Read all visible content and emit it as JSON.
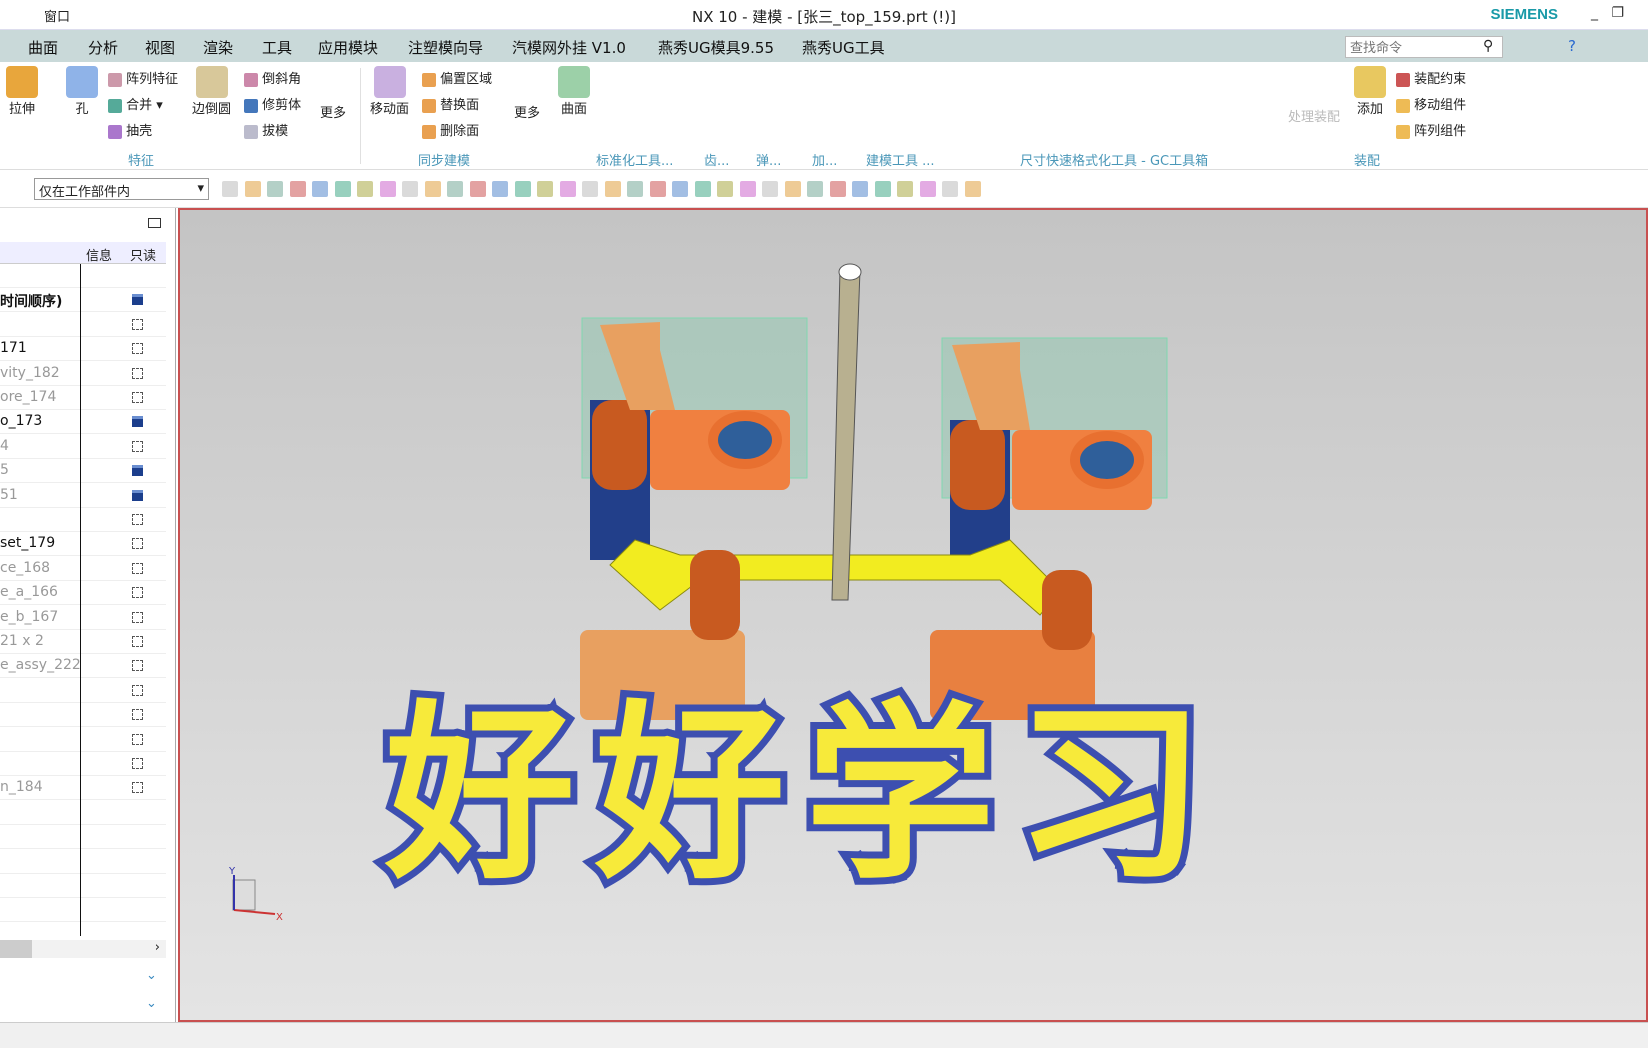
{
  "titlebar": {
    "title": "NX 10 - 建模 - [张三_top_159.prt  (!)]",
    "window_menu": "窗口",
    "brand": "SIEMENS"
  },
  "menubar": {
    "items": [
      "曲面",
      "分析",
      "视图",
      "渲染",
      "工具",
      "应用模块",
      "注塑模向导",
      "汽模网外挂 V1.0",
      "燕秀UG模具9.55",
      "燕秀UG工具"
    ],
    "search_placeholder": "查找命令"
  },
  "ribbon": {
    "feature": {
      "items": [
        "拉伸",
        "孔",
        "阵列特征",
        "合并",
        "抽壳",
        "边倒圆",
        "倒斜角",
        "修剪体",
        "拔模",
        "更多"
      ],
      "group": "特征"
    },
    "sync": {
      "items": [
        "移动面",
        "偏置区域",
        "替换面",
        "删除面",
        "更多"
      ],
      "group": "同步建模"
    },
    "surface": {
      "label": "曲面"
    },
    "groups": [
      "标准化工具...",
      "齿...",
      "弹...",
      "加...",
      "建模工具 ...",
      "尺寸快速格式化工具 - GC工具箱",
      "装配"
    ],
    "assembly": {
      "items": [
        "处理装配",
        "添加",
        "装配约束",
        "移动组件",
        "阵列组件"
      ]
    }
  },
  "toolbar": {
    "filter_value": "仅在工作部件内"
  },
  "navigator": {
    "columns": [
      "信息",
      "只读"
    ],
    "rows": [
      {
        "name": "",
        "ro": ""
      },
      {
        "name": "时间顺序)",
        "ro": "saved",
        "style": "b"
      },
      {
        "name": "",
        "ro": "box"
      },
      {
        "name": "171",
        "ro": "box",
        "style": "d"
      },
      {
        "name": "vity_182",
        "ro": "box"
      },
      {
        "name": "ore_174",
        "ro": "box"
      },
      {
        "name": "o_173",
        "ro": "saved",
        "style": "d"
      },
      {
        "name": "4",
        "ro": "box"
      },
      {
        "name": "5",
        "ro": "saved"
      },
      {
        "name": "51",
        "ro": "saved"
      },
      {
        "name": "",
        "ro": "box"
      },
      {
        "name": "set_179",
        "ro": "box",
        "style": "d"
      },
      {
        "name": "ce_168",
        "ro": "box"
      },
      {
        "name": "e_a_166",
        "ro": "box"
      },
      {
        "name": "e_b_167",
        "ro": "box"
      },
      {
        "name": "21 x 2",
        "ro": "box"
      },
      {
        "name": "e_assy_222",
        "ro": "box"
      },
      {
        "name": "",
        "ro": "box"
      },
      {
        "name": "",
        "ro": "box"
      },
      {
        "name": "",
        "ro": "box"
      },
      {
        "name": "",
        "ro": "box"
      },
      {
        "name": "n_184",
        "ro": "box"
      },
      {
        "name": "",
        "ro": ""
      },
      {
        "name": "",
        "ro": ""
      },
      {
        "name": "",
        "ro": ""
      },
      {
        "name": "",
        "ro": ""
      },
      {
        "name": "",
        "ro": ""
      }
    ]
  },
  "viewport": {
    "overlay_text": "好好学习",
    "triad": {
      "x": "X",
      "y": "Y"
    }
  },
  "colors": {
    "accent": "#4a97b8",
    "menubar": "#c9d9d9",
    "viewport_border": "#c85050"
  }
}
